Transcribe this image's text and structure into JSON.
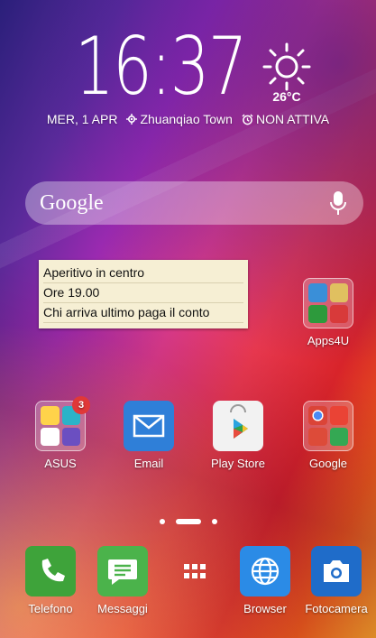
{
  "status": {
    "time": "16:37",
    "temperature": "26°C",
    "date": "MER, 1 APR",
    "location": "Zhuanqiao Town",
    "alarm": "NON ATTIVA"
  },
  "search": {
    "placeholder": "Google"
  },
  "note": {
    "lines": [
      "Aperitivo in centro",
      "Ore 19.00",
      "Chi arriva ultimo paga il conto"
    ]
  },
  "apps": {
    "apps4u": "Apps4U",
    "asus": "ASUS",
    "asus_badge": "3",
    "email": "Email",
    "playstore": "Play Store",
    "google": "Google"
  },
  "dock": {
    "phone": "Telefono",
    "messages": "Messaggi",
    "browser": "Browser",
    "camera": "Fotocamera"
  }
}
